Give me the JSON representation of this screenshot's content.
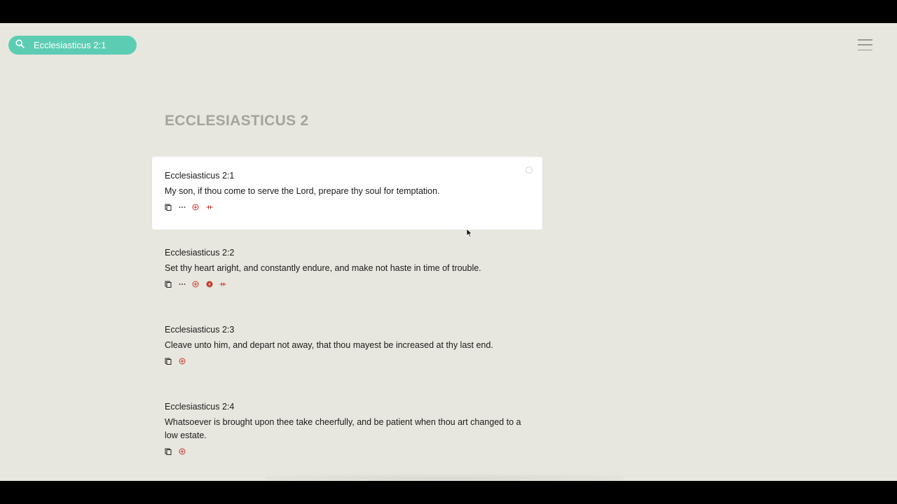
{
  "search": {
    "value": "Ecclesiasticus 2:1"
  },
  "chapter": {
    "title": "ECCLESIASTICUS 2"
  },
  "verses": [
    {
      "ref": "Ecclesiasticus 2:1",
      "text": "My son, if thou come to serve the Lord, prepare thy soul for temptation."
    },
    {
      "ref": "Ecclesiasticus 2:2",
      "text": "Set thy heart aright, and constantly endure, and make not haste in time of trouble."
    },
    {
      "ref": "Ecclesiasticus 2:3",
      "text": "Cleave unto him, and depart not away, that thou mayest be increased at thy last end."
    },
    {
      "ref": "Ecclesiasticus 2:4",
      "text": "Whatsoever is brought upon thee take cheerfully, and be patient when thou art changed to a low estate."
    }
  ],
  "colors": {
    "accent": "#5ccdb3",
    "action_red": "#c0392b",
    "background": "#e8e7df"
  },
  "icons": [
    "search-icon",
    "menu-icon",
    "copy-icon",
    "more-icon",
    "cross-reference-icon",
    "note-icon",
    "compare-icon"
  ]
}
